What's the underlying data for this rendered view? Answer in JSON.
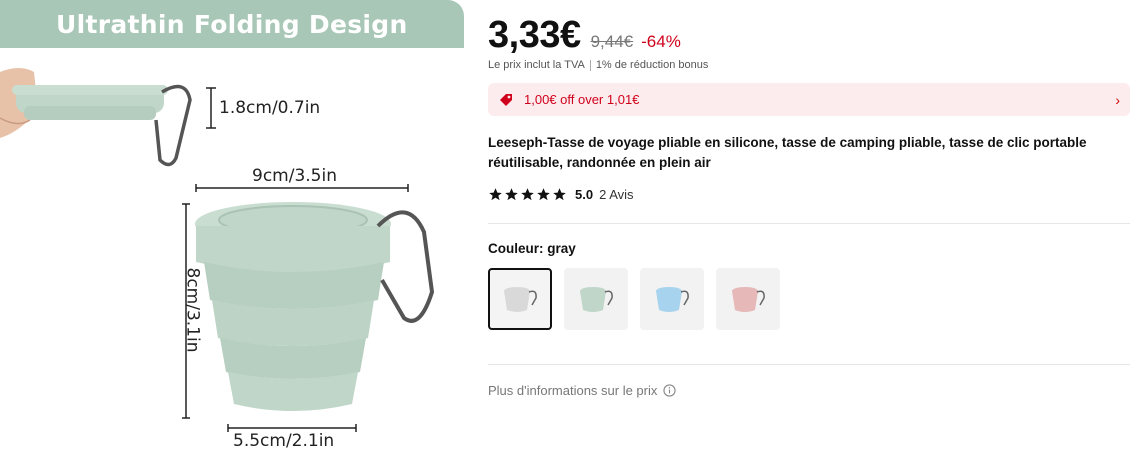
{
  "image": {
    "banner_text": "Ultrathin Folding Design",
    "dim_thickness": "1.8cm/0.7in",
    "dim_width": "9cm/3.5in",
    "dim_height": "8cm/3.1in",
    "dim_base": "5.5cm/2.1in",
    "cup_color": "#bfd6c9"
  },
  "price": {
    "current": "3,33€",
    "original": "9,44€",
    "discount": "-64%",
    "vat_note": "Le prix inclut la TVA",
    "bonus_note": "1% de réduction bonus"
  },
  "promo": {
    "text": "1,00€ off over 1,01€",
    "icon": "tag-icon",
    "chevron": "›"
  },
  "product": {
    "title": "Leeseph-Tasse de voyage pliable en silicone, tasse de camping pliable, tasse de clic portable réutilisable, randonnée en plein air",
    "rating": "5.0",
    "reviews": "2 Avis",
    "stars": 5
  },
  "color": {
    "label": "Couleur: gray",
    "options": [
      {
        "name": "gray",
        "hex": "#d9d9d9",
        "selected": true
      },
      {
        "name": "green",
        "hex": "#bfd6c9",
        "selected": false
      },
      {
        "name": "blue",
        "hex": "#a7d3ee",
        "selected": false
      },
      {
        "name": "pink",
        "hex": "#e6b8b8",
        "selected": false
      }
    ]
  },
  "more_info": "Plus d'informations sur le prix",
  "colors": {
    "accent_red": "#d0021b",
    "promo_bg": "#fdecee"
  }
}
